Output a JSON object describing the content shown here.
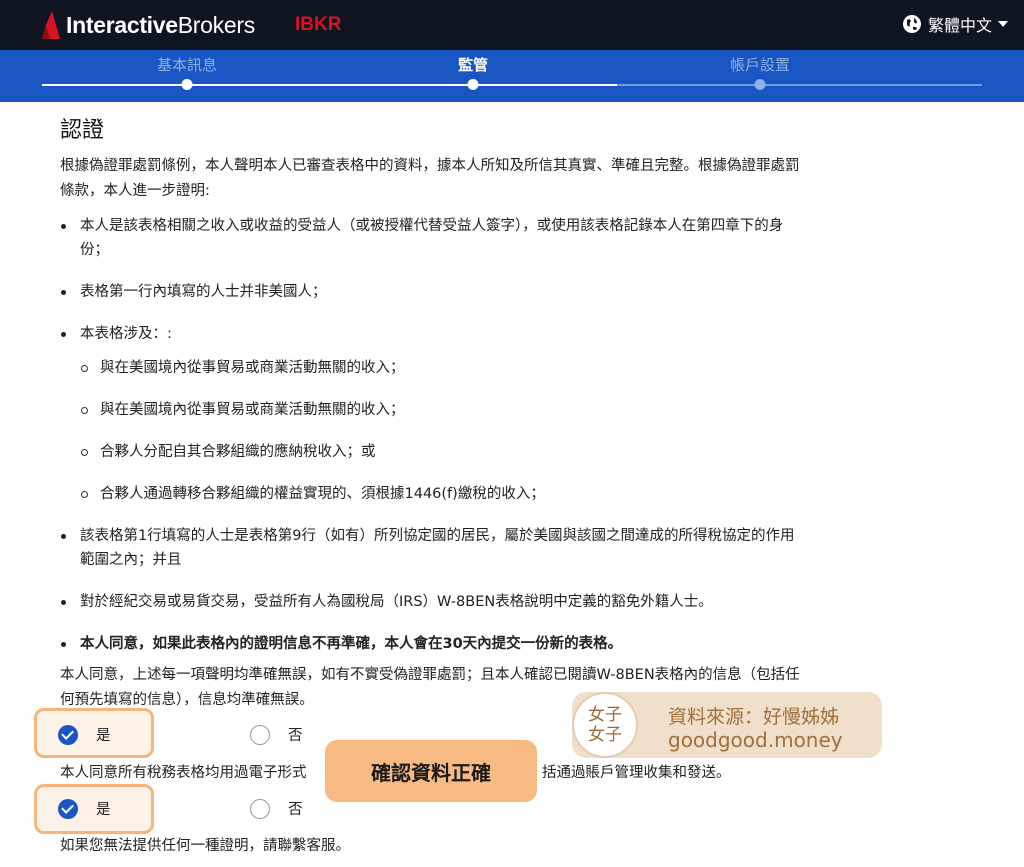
{
  "header": {
    "logo_main": "Interactive",
    "logo_rest": "Brokers",
    "ticker": "IBKR",
    "language": "繁體中文"
  },
  "steps": [
    {
      "label": "基本訊息",
      "state": "done"
    },
    {
      "label": "監管",
      "state": "active"
    },
    {
      "label": "帳戶設置",
      "state": "upcoming"
    }
  ],
  "content": {
    "title": "認證",
    "intro": "根據偽證罪處罰條例，本人聲明本人已審查表格中的資料，據本人所知及所信其真實、準確且完整。根據偽證罪處罰條款，本人進一步證明:",
    "bullets": [
      "本人是該表格相關之收入或收益的受益人（或被授權代替受益人簽字），或使用該表格記錄本人在第四章下的身份；",
      "表格第一行內填寫的人士并非美國人；",
      "本表格涉及：:"
    ],
    "sub_bullets": [
      "與在美國境內從事貿易或商業活動無關的收入；",
      "與在美國境內從事貿易或商業活動無關的收入；",
      "合夥人分配自其合夥組織的應納稅收入；或",
      "合夥人通過轉移合夥組織的權益實現的、須根據1446(f)繳稅的收入；"
    ],
    "bullets_after": [
      "該表格第1行填寫的人士是表格第9行（如有）所列協定國的居民，屬於美國與該國之間達成的所得稅協定的作用範圍之內；并且",
      "對於經紀交易或易貨交易，受益所有人為國稅局（IRS）W-8BEN表格說明中定義的豁免外籍人士。"
    ],
    "bold_bullet": "本人同意，如果此表格內的證明信息不再準確，本人會在30天內提交一份新的表格。",
    "agree1": "本人同意，上述每一項聲明均準確無誤，如有不實受偽證罪處罰；且本人確認已閱讀W-8BEN表格內的信息（包括任何預先填寫的信息），信息均準確無誤。",
    "agree2_left": "本人同意所有稅務表格均用過電子形式",
    "agree2_right": "括通過賬戶管理收集和發送。",
    "footer": "如果您無法提供任何一種證明，請聯繫客服。"
  },
  "radios": {
    "q1": {
      "yes": "是",
      "no": "否",
      "selected": "yes"
    },
    "q2": {
      "yes": "是",
      "no": "否",
      "selected": "yes"
    }
  },
  "overlay": {
    "callout": "確認資料正確",
    "badge_char1": "女子",
    "badge_char2": "女子",
    "badge_line1": "資料來源：好慢姊姊",
    "badge_line2": "goodgood.money"
  },
  "colors": {
    "topbar": "#0e1520",
    "stepbar": "#1a55c4",
    "brand_red": "#d81222",
    "highlight": "#f6ba82"
  }
}
